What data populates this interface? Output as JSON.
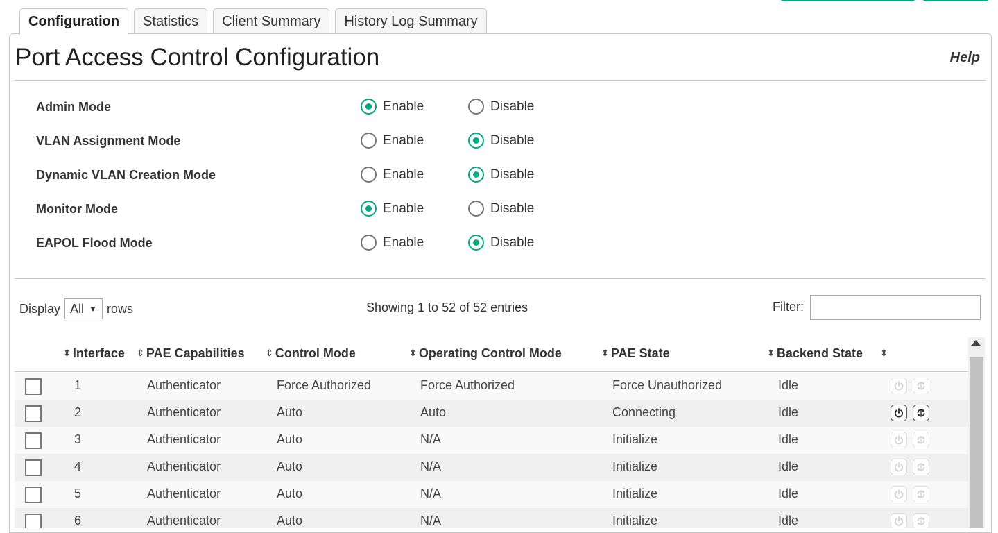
{
  "tabs": [
    "Configuration",
    "Statistics",
    "Client Summary",
    "History Log Summary"
  ],
  "page": {
    "title": "Port Access Control Configuration",
    "help": "Help"
  },
  "options": {
    "enable": "Enable",
    "disable": "Disable"
  },
  "config_rows": [
    {
      "label": "Admin Mode",
      "selected": "enable"
    },
    {
      "label": "VLAN Assignment Mode",
      "selected": "disable"
    },
    {
      "label": "Dynamic VLAN Creation Mode",
      "selected": "disable"
    },
    {
      "label": "Monitor Mode",
      "selected": "enable"
    },
    {
      "label": "EAPOL Flood Mode",
      "selected": "disable"
    }
  ],
  "table_controls": {
    "display_label": "Display",
    "display_value": "All",
    "rows_label": "rows",
    "showing": "Showing 1 to 52 of 52 entries",
    "filter_label": "Filter:"
  },
  "columns": [
    "Interface",
    "PAE Capabilities",
    "Control Mode",
    "Operating Control Mode",
    "PAE State",
    "Backend State"
  ],
  "rows": [
    [
      "1",
      "Authenticator",
      "Force Authorized",
      "Force Authorized",
      "Force Unauthorized",
      "Idle"
    ],
    [
      "2",
      "Authenticator",
      "Auto",
      "Auto",
      "Connecting",
      "Idle"
    ],
    [
      "3",
      "Authenticator",
      "Auto",
      "N/A",
      "Initialize",
      "Idle"
    ],
    [
      "4",
      "Authenticator",
      "Auto",
      "N/A",
      "Initialize",
      "Idle"
    ],
    [
      "5",
      "Authenticator",
      "Auto",
      "N/A",
      "Initialize",
      "Idle"
    ],
    [
      "6",
      "Authenticator",
      "Auto",
      "N/A",
      "Initialize",
      "Idle"
    ]
  ],
  "row_actions_enabled": [
    false,
    true,
    false,
    false,
    false,
    false
  ],
  "icons": {
    "sort": "sort-icon",
    "power": "power-icon",
    "reauth": "reauthenticate-icon"
  },
  "colors": {
    "accent": "#01a982",
    "border": "#c6c6c6"
  }
}
